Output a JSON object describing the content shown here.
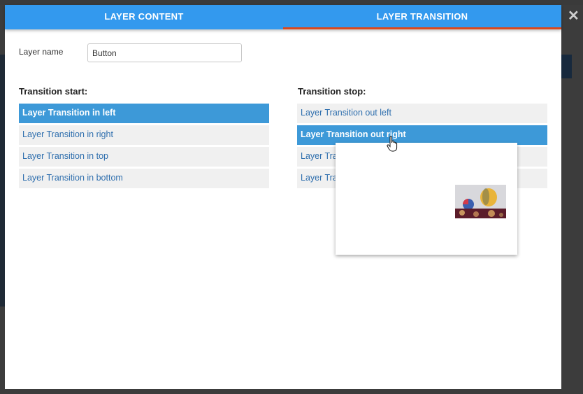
{
  "tabs": [
    {
      "label": "LAYER CONTENT",
      "active": false
    },
    {
      "label": "LAYER TRANSITION",
      "active": true
    }
  ],
  "layer_name": {
    "label": "Layer name",
    "value": "Button"
  },
  "transition_start": {
    "title": "Transition start:",
    "items": [
      {
        "label": "Layer Transition in left",
        "selected": true
      },
      {
        "label": "Layer Transition in right",
        "selected": false
      },
      {
        "label": "Layer Transition in top",
        "selected": false
      },
      {
        "label": "Layer Transition in bottom",
        "selected": false
      }
    ]
  },
  "transition_stop": {
    "title": "Transition stop:",
    "items": [
      {
        "label": "Layer Transition out left",
        "selected": false
      },
      {
        "label": "Layer Transition out right",
        "selected": true
      },
      {
        "label": "Layer Transition out top",
        "selected": false
      },
      {
        "label": "Layer Transition out bottom",
        "selected": false
      }
    ]
  },
  "preview": {
    "image": "hot-air-balloons-thumbnail"
  },
  "close_icon": "✕",
  "colors": {
    "tab_bar": "#3399ee",
    "active_underline": "#d9481f",
    "selected_item": "#3d99d8",
    "item_bg": "#f0f0f0",
    "item_text": "#2f6fae"
  }
}
